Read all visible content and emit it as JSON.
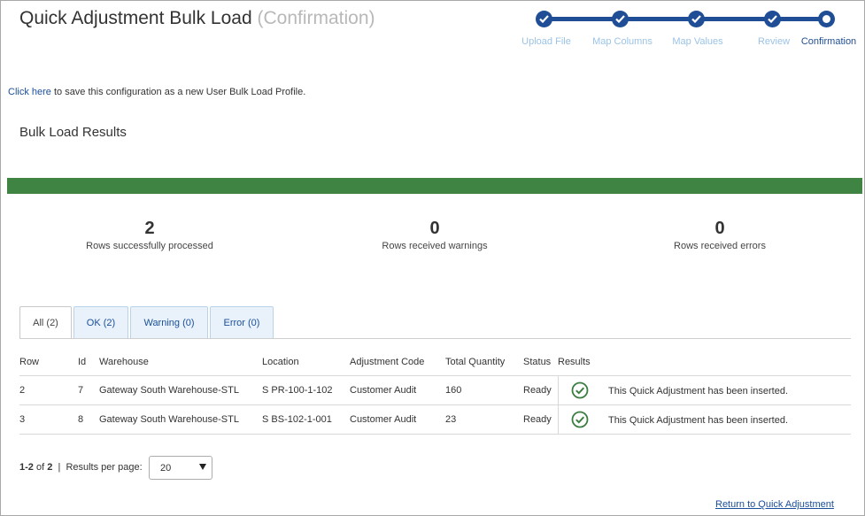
{
  "header": {
    "title": "Quick Adjustment Bulk Load",
    "subtitle": "(Confirmation)"
  },
  "stepper": {
    "accent_color": "#1f4e96",
    "inactive_label_color": "#9bc3e6",
    "steps": [
      {
        "label": "Upload File",
        "state": "complete"
      },
      {
        "label": "Map Columns",
        "state": "complete"
      },
      {
        "label": "Map Values",
        "state": "complete"
      },
      {
        "label": "Review",
        "state": "complete"
      },
      {
        "label": "Confirmation",
        "state": "current"
      }
    ]
  },
  "save_profile": {
    "link_text": "Click here",
    "rest_text": " to save this configuration as a new User Bulk Load Profile."
  },
  "results": {
    "section_title": "Bulk Load Results",
    "progress_fraction": 1.0,
    "progress_color": "#3f8443",
    "stats": [
      {
        "value": "2",
        "label": "Rows successfully processed"
      },
      {
        "value": "0",
        "label": "Rows received warnings"
      },
      {
        "value": "0",
        "label": "Rows received errors"
      }
    ]
  },
  "tabs": [
    {
      "label": "All (2)",
      "active": true
    },
    {
      "label": "OK (2)",
      "active": false
    },
    {
      "label": "Warning (0)",
      "active": false
    },
    {
      "label": "Error (0)",
      "active": false
    }
  ],
  "table": {
    "headers": [
      "Row",
      "Id",
      "Warehouse",
      "Location",
      "Adjustment Code",
      "Total Quantity",
      "Status",
      "Results"
    ],
    "rows": [
      {
        "row": "2",
        "id": "7",
        "warehouse": "Gateway South Warehouse-STL",
        "location": "S PR-100-1-102",
        "adjustment_code": "Customer Audit",
        "total_quantity": "160",
        "status": "Ready",
        "result_icon": "check-circle-icon",
        "result_message": "This Quick Adjustment has been inserted."
      },
      {
        "row": "3",
        "id": "8",
        "warehouse": "Gateway South Warehouse-STL",
        "location": "S BS-102-1-001",
        "adjustment_code": "Customer Audit",
        "total_quantity": "23",
        "status": "Ready",
        "result_icon": "check-circle-icon",
        "result_message": "This Quick Adjustment has been inserted."
      }
    ],
    "success_color": "#3a7d3e"
  },
  "pagination": {
    "range": "1-2",
    "of_text": " of ",
    "total": "2",
    "separator": "|",
    "per_page_label": "Results per page:",
    "per_page_value": "20"
  },
  "footer": {
    "return_link": "Return to Quick Adjustment"
  }
}
